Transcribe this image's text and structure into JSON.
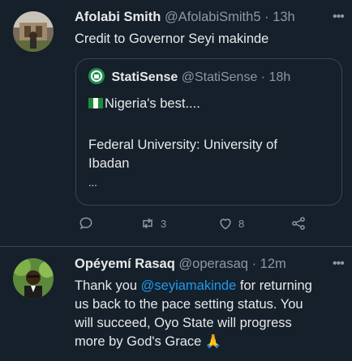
{
  "tweet1": {
    "name": "Afolabi Smith",
    "handle": "@AfolabiSmith5",
    "time": "13h",
    "text": "Credit to Governor Seyi makinde",
    "quote": {
      "name": "StatiSense",
      "handle": "@StatiSense",
      "time": "18h",
      "line1": "Nigeria's best....",
      "line2": "Federal University: University of",
      "line3": "Ibadan",
      "line4": "..."
    },
    "retweets": "3",
    "likes": "8"
  },
  "tweet2": {
    "name": "Opéyemí Rasaq",
    "handle": "@operasaq",
    "time": "12m",
    "text_pre": "Thank you ",
    "mention": "@seyiamakinde",
    "text_post": " for returning",
    "line2": "us back to the pace setting status. You",
    "line3": "will succeed, Oyo State will progress",
    "line4": "more by God's Grace 🙏"
  },
  "separator": "·",
  "colors": {
    "background": "#15202b",
    "link": "#1d9bf0",
    "muted": "#8b98a5",
    "border": "#38444d"
  }
}
